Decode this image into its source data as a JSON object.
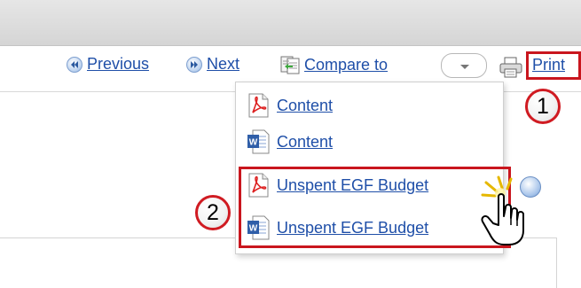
{
  "toolbar": {
    "previous_label": "Previous",
    "next_label": "Next",
    "compare_label": "Compare to",
    "print_label": "Print",
    "compare_select_value": ""
  },
  "dropdown": {
    "items": [
      {
        "label": "Content",
        "icon": "pdf-icon"
      },
      {
        "label": "Content",
        "icon": "word-icon"
      },
      {
        "label": "Unspent EGF Budget",
        "icon": "pdf-icon"
      },
      {
        "label": "Unspent EGF Budget",
        "icon": "word-icon"
      }
    ]
  },
  "callouts": {
    "step1": "1",
    "step2": "2"
  },
  "colors": {
    "link": "#1f4fa8",
    "highlight": "#c9161e"
  }
}
